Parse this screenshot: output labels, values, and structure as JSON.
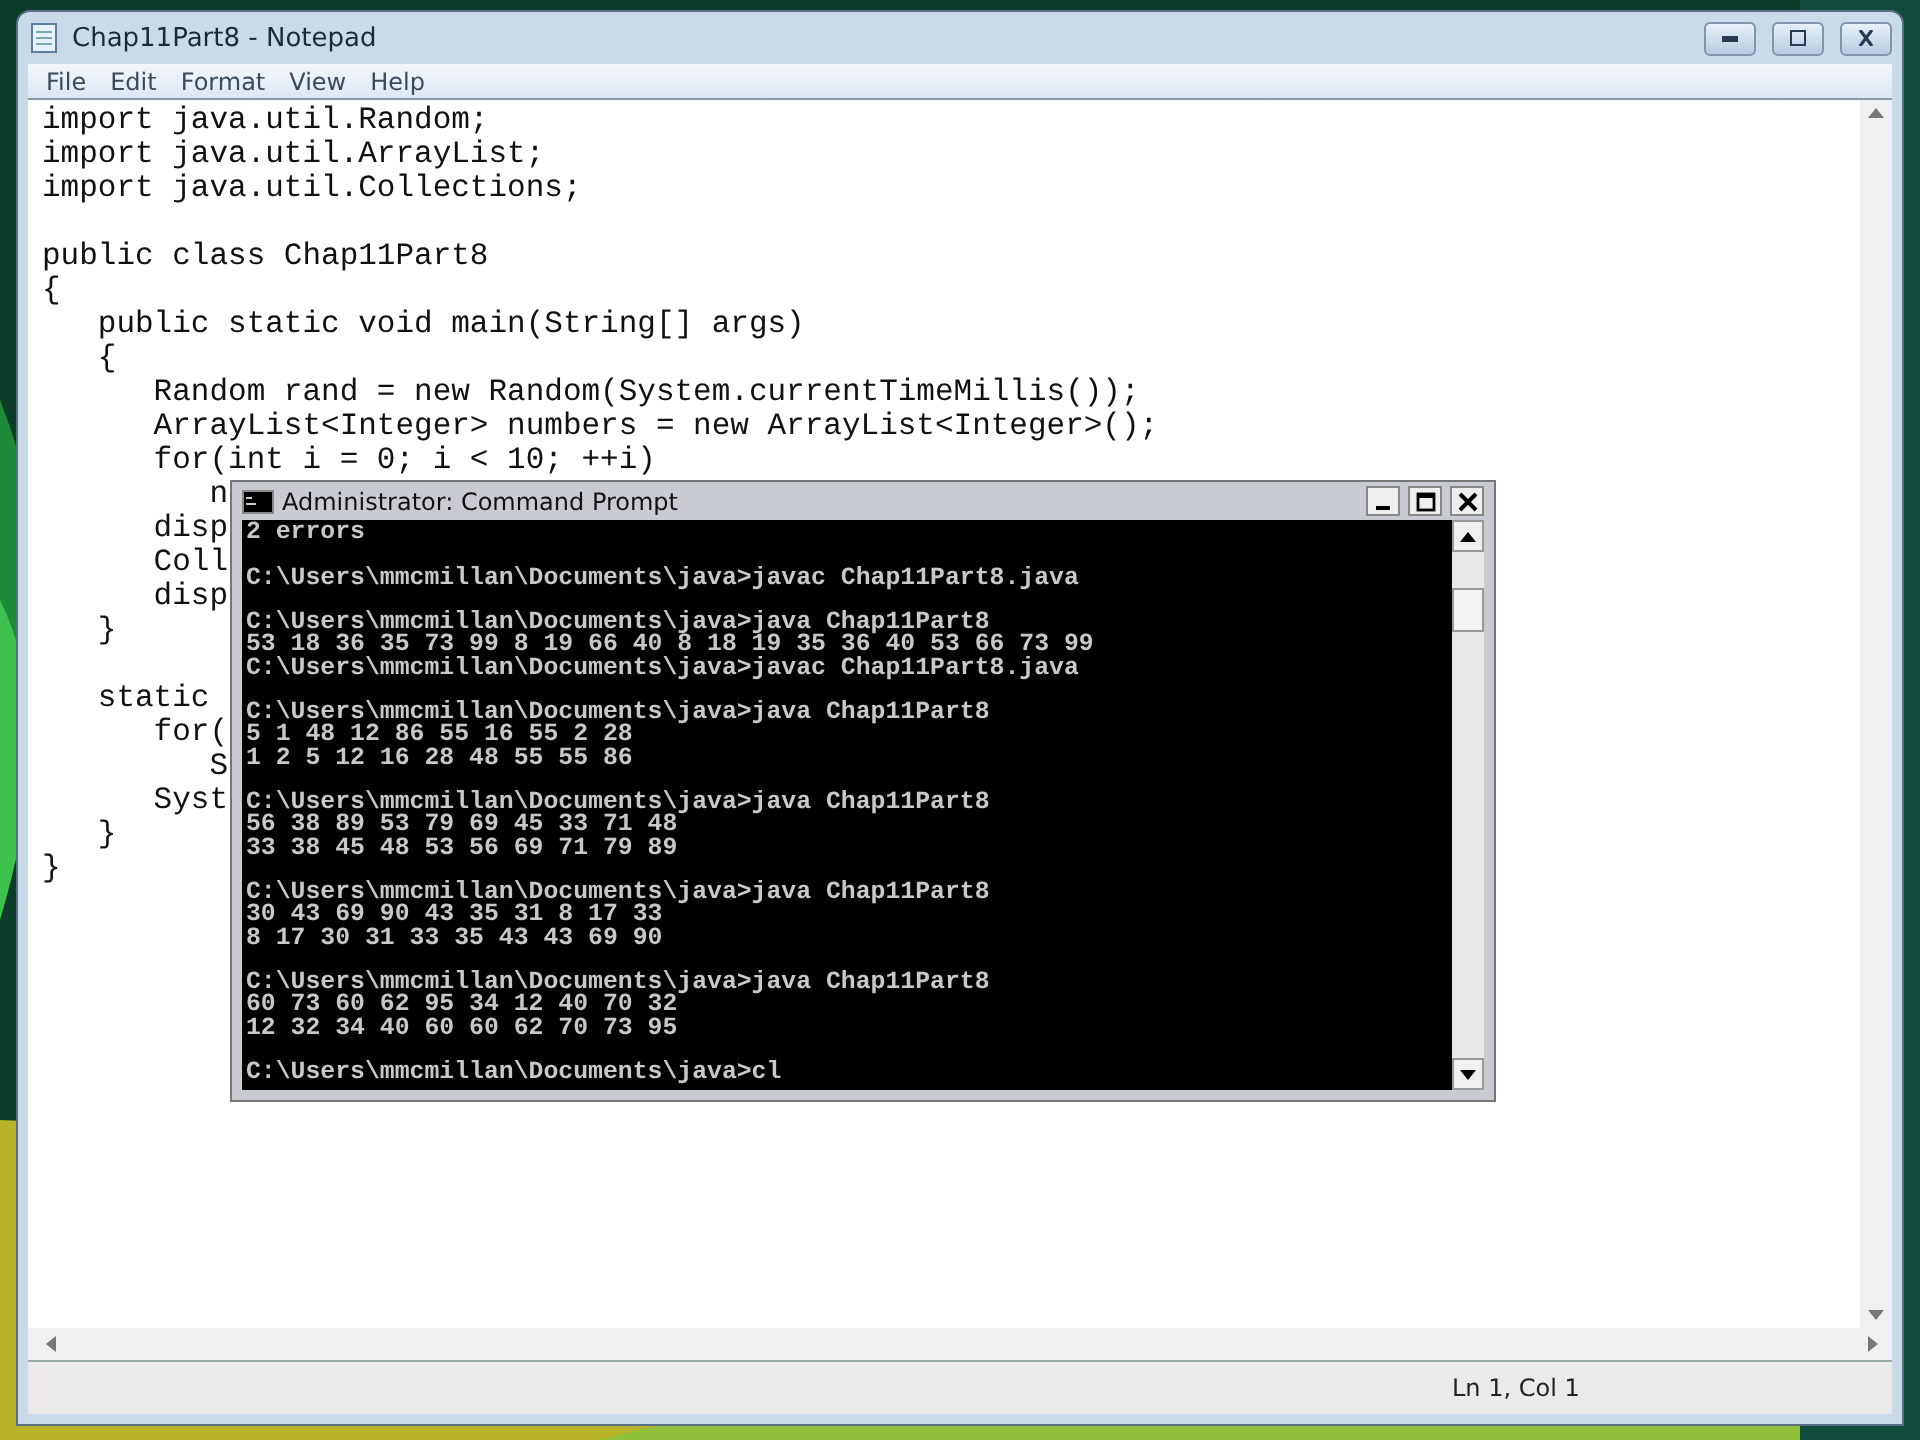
{
  "notepad": {
    "title": "Chap11Part8 - Notepad",
    "menu": [
      "File",
      "Edit",
      "Format",
      "View",
      "Help"
    ],
    "blocks": [
      [
        "import java.util.Random;",
        "import java.util.ArrayList;",
        "import java.util.Collections;"
      ],
      [
        "public class Chap11Part8",
        "{",
        "   public static void main(String[] args)",
        "   {",
        "      Random rand = new Random(System.currentTimeMillis());",
        "      ArrayList<Integer> numbers = new ArrayList<Integer>();",
        "      for(int i = 0; i < 10; ++i)",
        "         n",
        "      disp",
        "      Coll",
        "      disp",
        "   }"
      ],
      [
        "   static",
        "      for(",
        "         S",
        "      Syst",
        "   }",
        "}"
      ]
    ],
    "status": "Ln 1, Col 1"
  },
  "console": {
    "title": "Administrator: Command Prompt",
    "blocks": [
      [
        "2 errors"
      ],
      [
        "C:\\Users\\mmcmillan\\Documents\\java>javac Chap11Part8.java"
      ],
      [
        "C:\\Users\\mmcmillan\\Documents\\java>java Chap11Part8",
        "53 18 36 35 73 99 8 19 66 40 8 18 19 35 36 40 53 66 73 99",
        "C:\\Users\\mmcmillan\\Documents\\java>javac Chap11Part8.java"
      ],
      [
        "C:\\Users\\mmcmillan\\Documents\\java>java Chap11Part8",
        "5 1 48 12 86 55 16 55 2 28",
        "1 2 5 12 16 28 48 55 55 86"
      ],
      [
        "C:\\Users\\mmcmillan\\Documents\\java>java Chap11Part8",
        "56 38 89 53 79 69 45 33 71 48",
        "33 38 45 48 53 56 69 71 79 89"
      ],
      [
        "C:\\Users\\mmcmillan\\Documents\\java>java Chap11Part8",
        "30 43 69 90 43 35 31 8 17 33",
        "8 17 30 31 33 35 43 43 69 90"
      ],
      [
        "C:\\Users\\mmcmillan\\Documents\\java>java Chap11Part8",
        "60 73 60 62 95 34 12 40 70 32",
        "12 32 34 40 60 60 62 70 73 95"
      ],
      [
        "C:\\Users\\mmcmillan\\Documents\\java>cl"
      ]
    ]
  }
}
